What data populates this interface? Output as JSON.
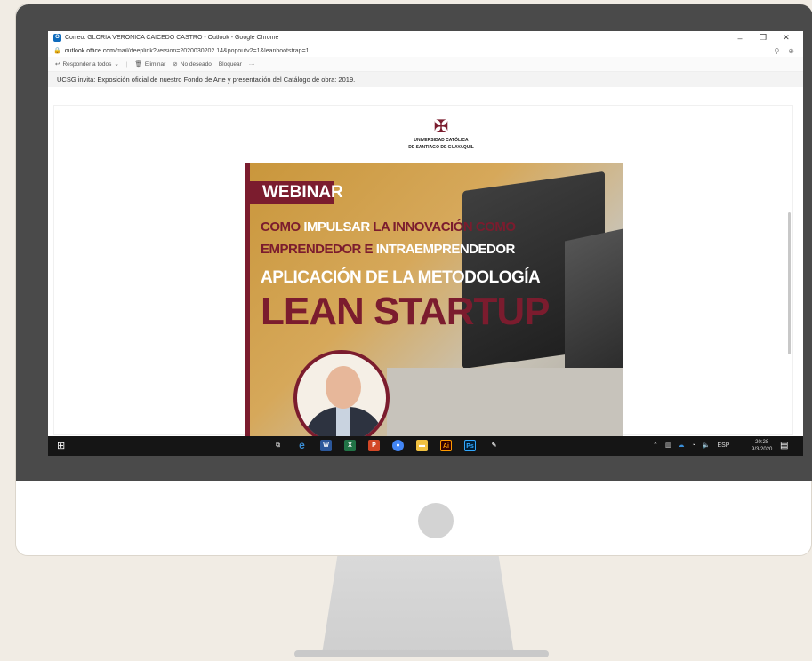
{
  "window": {
    "title": "Correo: GLORIA VERONICA CAICEDO CASTRO - Outlook - Google Chrome",
    "controls": [
      "–",
      "❐",
      "✕"
    ]
  },
  "address": {
    "url_domain": "outlook.office.com",
    "url_path": "/mail/deeplink?version=2020030202.14&popoutv2=1&leanbootstrap=1"
  },
  "toolbar": {
    "reply_all": "Responder a todos",
    "delete": "Eliminar",
    "junk": "No deseado",
    "block": "Bloquear",
    "more": "···"
  },
  "email": {
    "subject": "UCSG invita: Exposición oficial de nuestro Fondo de Arte y presentación del Catálogo de obra: 2019."
  },
  "logo": {
    "line1": "UNIVERSIDAD CATÓLICA",
    "line2": "DE SANTIAGO DE GUAYAQUIL"
  },
  "banner": {
    "tag": "WEBINAR",
    "line1_a": "COMO",
    "line1_b": "IMPULSAR",
    "line1_c": "LA INNOVACIÓN COMO",
    "line2_a": "EMPRENDEDOR E",
    "line2_b": "INTRAEMPRENDEDOR",
    "line3": "APLICACIÓN DE LA METODOLOGÍA",
    "line4": "LEAN STARTUP"
  },
  "taskbar": {
    "lang": "ESP",
    "time": "20:28",
    "date": "9/3/2020"
  },
  "colors": {
    "brand": "#7b1c2e",
    "bezel": "#4a4a4a",
    "background": "#f1ece4"
  }
}
